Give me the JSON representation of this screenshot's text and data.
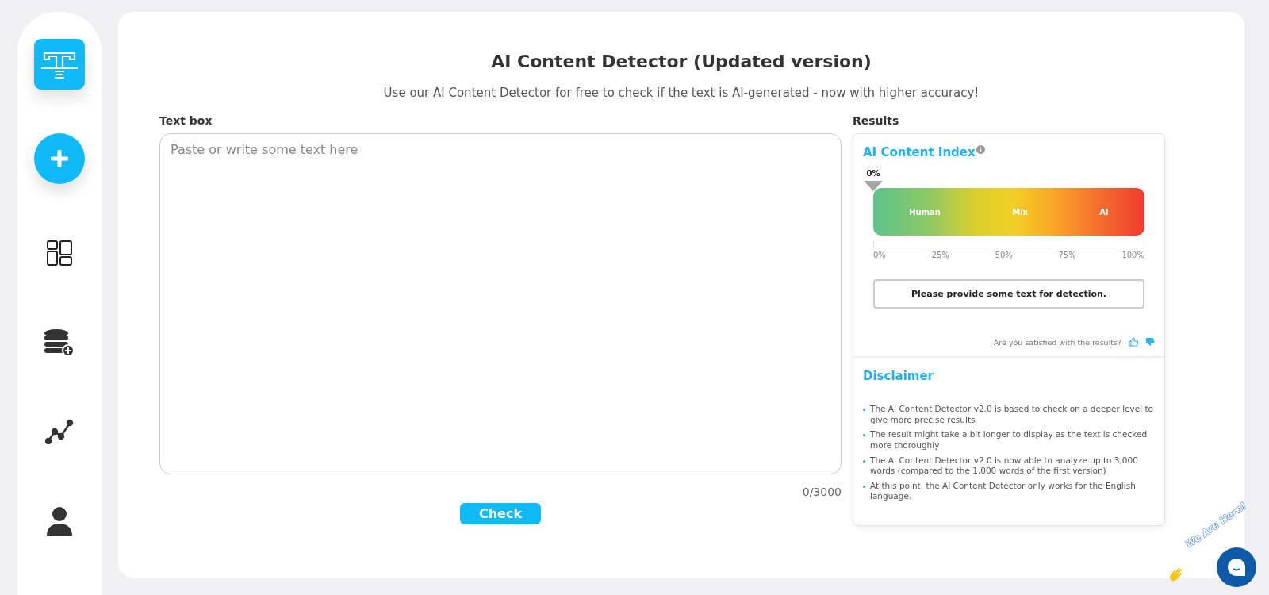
{
  "page": {
    "title": "AI Content Detector (Updated version)",
    "subtitle": "Use our AI Content Detector for free to check if the text is AI-generated - now with higher accuracy!"
  },
  "text_box": {
    "label": "Text box",
    "placeholder": "Paste or write some text here",
    "counter": "0/3000",
    "button": "Check"
  },
  "results": {
    "label": "Results",
    "index_title": "AI Content Index",
    "pointer_label": "0%",
    "level": 0,
    "zones": [
      "Human",
      "Mix",
      "AI"
    ],
    "ticks": [
      "0%",
      "25%",
      "50%",
      "75%",
      "100%"
    ],
    "message": "Please provide some text for detection.",
    "feedback": "Are you satisfied with the results?"
  },
  "disclaimer": {
    "title": "Disclaimer",
    "items": [
      "The AI Content Detector v2.0 is based to check on a deeper level to give more precise results",
      "The result might take a bit longer to display as the text is checked more thoroughly",
      "The AI Content Detector v2.0 is now able to analyze up to 3,000 words (compared to the 1,000 words of the first version)",
      "At this point, the AI Content Detector only works for the English language."
    ]
  },
  "chat": {
    "badge": "We Are Here!"
  }
}
